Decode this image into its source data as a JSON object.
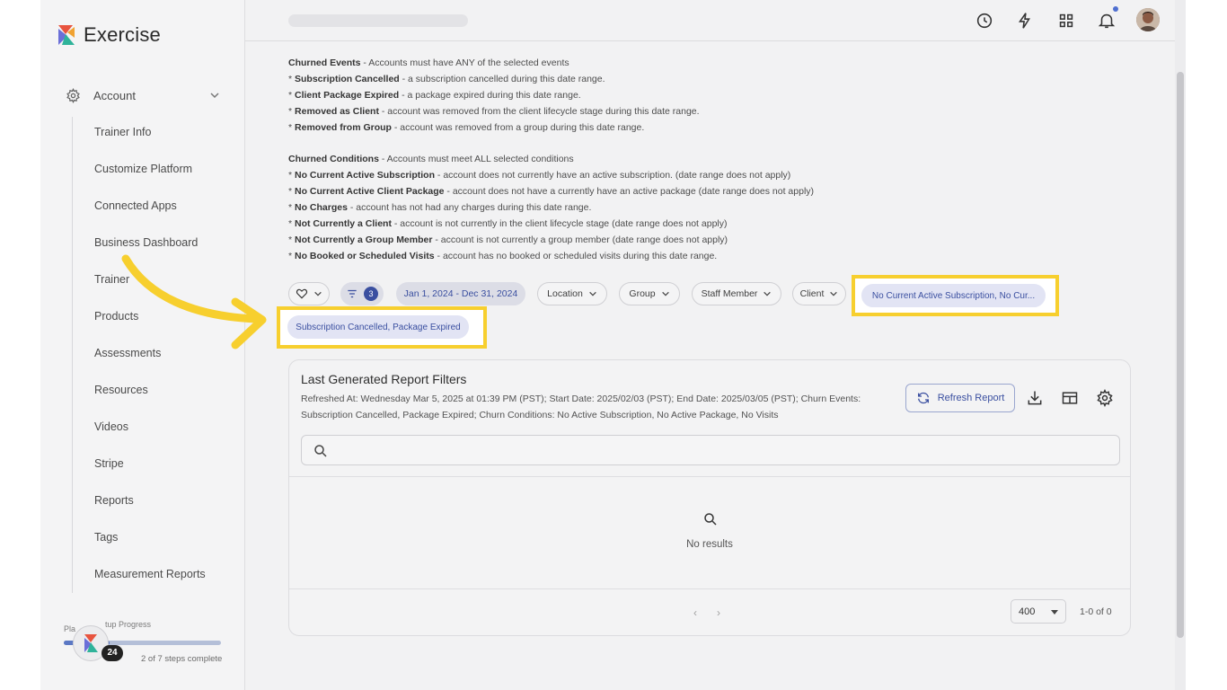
{
  "app": {
    "name": "Exercise"
  },
  "sidebar": {
    "account_label": "Account",
    "items": [
      {
        "label": "Trainer Info"
      },
      {
        "label": "Customize Platform"
      },
      {
        "label": "Connected Apps"
      },
      {
        "label": "Business Dashboard"
      },
      {
        "label": "Trainer"
      },
      {
        "label": "Products"
      },
      {
        "label": "Assessments"
      },
      {
        "label": "Resources"
      },
      {
        "label": "Videos"
      },
      {
        "label": "Stripe"
      },
      {
        "label": "Reports"
      },
      {
        "label": "Tags"
      },
      {
        "label": "Measurement Reports"
      }
    ],
    "progress": {
      "label_left": "Pla",
      "label_right": "tup Progress",
      "steps": "2 of 7 steps complete",
      "badge": "24",
      "fraction": 0.29
    }
  },
  "header": {
    "icons": [
      "history-icon",
      "bolt-icon",
      "apps-grid-icon",
      "bell-icon"
    ]
  },
  "descriptions": {
    "events_title": "Churned Events",
    "events_intro": " - Accounts must have ANY of the selected events",
    "events": [
      {
        "name": "Subscription Cancelled",
        "text": " - a subscription cancelled during this date range."
      },
      {
        "name": "Client Package Expired",
        "text": " - a package expired during this date range."
      },
      {
        "name": "Removed as Client",
        "text": " - account was removed from the client lifecycle stage during this date range."
      },
      {
        "name": "Removed from Group",
        "text": " - account was removed from a group during this date range."
      }
    ],
    "conditions_title": "Churned Conditions",
    "conditions_intro": " - Accounts must meet ALL selected conditions",
    "conditions": [
      {
        "name": "No Current Active Subscription",
        "text": " - account does not currently have an active subscription. (date range does not apply)"
      },
      {
        "name": "No Current Active Client Package",
        "text": " - account does not have a currently have an active package (date range does not apply)"
      },
      {
        "name": "No Charges",
        "text": " - account has not had any charges during this date range."
      },
      {
        "name": "Not Currently a Client",
        "text": " - account is not currently in the client lifecycle stage (date range does not apply)"
      },
      {
        "name": "Not Currently a Group Member",
        "text": " - account is not currently a group member (date range does not apply)"
      },
      {
        "name": "No Booked or Scheduled Visits",
        "text": " - account has no booked or scheduled visits during this date range."
      }
    ]
  },
  "filters": {
    "filter_count": "3",
    "date_range": "Jan 1, 2024 - Dec 31, 2024",
    "location": "Location",
    "group": "Group",
    "staff_member": "Staff Member",
    "client": "Client",
    "conditions_chip": "No Current Active Subscription, No Cur...",
    "events_chip": "Subscription Cancelled, Package Expired"
  },
  "report": {
    "title": "Last Generated Report Filters",
    "meta": "Refreshed At: Wednesday Mar 5, 2025 at 01:39 PM (PST); Start Date: 2025/02/03 (PST); End Date: 2025/03/05 (PST); Churn Events: Subscription Cancelled, Package Expired; Churn Conditions: No Active Subscription, No Active Package, No Visits",
    "refresh_label": "Refresh Report",
    "search_placeholder": "",
    "empty_text": "No results",
    "per_page": "400",
    "page_info": "1-0 of 0"
  },
  "colors": {
    "accent": "#3a4fa0",
    "highlight": "#f7cf2e"
  }
}
